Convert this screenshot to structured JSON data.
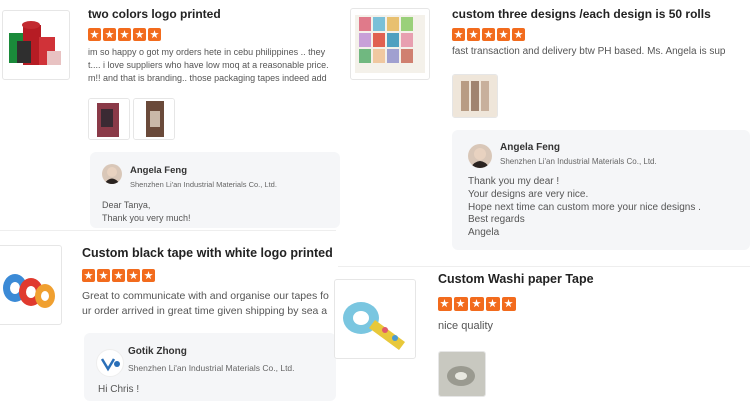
{
  "reviews": [
    {
      "title": "two colors logo printed",
      "text_line1": "im so happy o got my orders hete in cebu philippines .. they",
      "text_line2": "t.... i love suppliers who have low moq at a reasonable price.",
      "text_line3": "m!! and that is branding.. those packaging tapes indeed add",
      "reply": {
        "name": "Angela Feng",
        "company": "Shenzhen Li'an Industrial Materials Co., Ltd.",
        "text": "Dear Tanya,\nThank you very much!"
      }
    },
    {
      "title": "custom three designs /each design is 50 rolls",
      "text_line1": "fast transaction and delivery btw PH based. Ms. Angela is sup",
      "reply": {
        "name": "Angela Feng",
        "company": "Shenzhen Li'an Industrial Materials Co., Ltd.",
        "text": "Thank you my dear !\nYour designs are very nice.\nHope next time can custom more your nice designs .\nBest regards\nAngela"
      }
    },
    {
      "title": "Custom black tape with white logo printed",
      "text_line1": "Great to communicate with and organise our tapes fo",
      "text_line2": "ur order arrived in great time given shipping by sea a",
      "reply": {
        "name": "Gotik Zhong",
        "company": "Shenzhen Li'an Industrial Materials Co., Ltd.",
        "text": "Hi Chris !"
      }
    },
    {
      "title": "Custom Washi paper Tape",
      "text_line1": "nice quality"
    }
  ],
  "colors": {
    "star": "#f26b1d",
    "reply_bg": "#f5f6f8"
  }
}
